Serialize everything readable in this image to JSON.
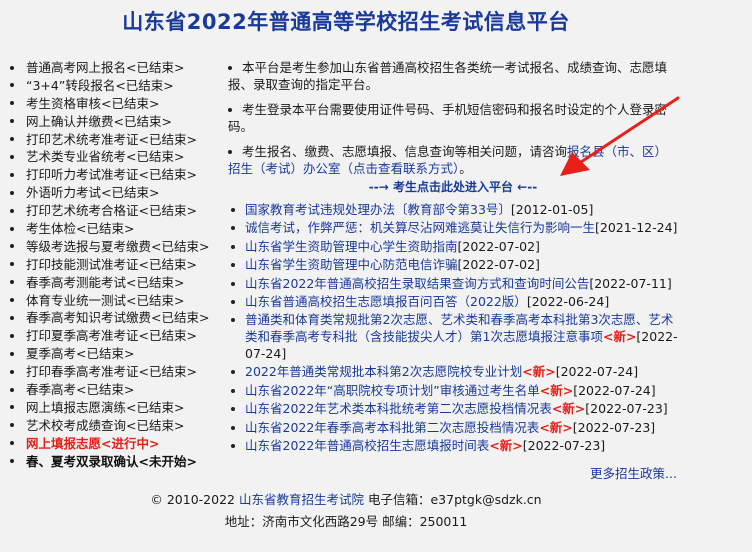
{
  "page_title": "山东省2022年普通高等学校招生考试信息平台",
  "left_nav": [
    {
      "label": "普通高考网上报名<已结束>",
      "state": "done"
    },
    {
      "label": "“3+4”转段报名<已结束>",
      "state": "done"
    },
    {
      "label": "考生资格审核<已结束>",
      "state": "done"
    },
    {
      "label": "网上确认并缴费<已结束>",
      "state": "done"
    },
    {
      "label": "打印艺术统考准考证<已结束>",
      "state": "done"
    },
    {
      "label": "艺术类专业省统考<已结束>",
      "state": "done"
    },
    {
      "label": "打印听力考试准考证<已结束>",
      "state": "done"
    },
    {
      "label": "外语听力考试<已结束>",
      "state": "done"
    },
    {
      "label": "打印艺术统考合格证<已结束>",
      "state": "done"
    },
    {
      "label": "考生体检<已结束>",
      "state": "done"
    },
    {
      "label": "等级考选报与夏考缴费<已结束>",
      "state": "done"
    },
    {
      "label": "打印技能测试准考证<已结束>",
      "state": "done"
    },
    {
      "label": "春季高考测能考试<已结束>",
      "state": "done"
    },
    {
      "label": "体育专业统一测试<已结束>",
      "state": "done"
    },
    {
      "label": "春季高考知识考试缴费<已结束>",
      "state": "done"
    },
    {
      "label": "打印夏季高考准考证<已结束>",
      "state": "done"
    },
    {
      "label": "夏季高考<已结束>",
      "state": "done"
    },
    {
      "label": "打印春季高考准考证<已结束>",
      "state": "done"
    },
    {
      "label": "春季高考<已结束>",
      "state": "done"
    },
    {
      "label": "网上填报志愿演练<已结束>",
      "state": "done"
    },
    {
      "label": "艺术校考成绩查询<已结束>",
      "state": "done"
    },
    {
      "label": "网上填报志愿<进行中>",
      "state": "active"
    },
    {
      "label": "春、夏考双录取确认<未开始>",
      "state": "pending"
    }
  ],
  "intro": {
    "p1": "本平台是考生参加山东省普通高校招生各类统一考试报名、成绩查询、志愿填报、录取查询的指定平台。",
    "p2": "考生登录本平台需要使用证件号码、手机短信密码和报名时设定的个人登录密码。",
    "p3_prefix": "考生报名、缴费、志愿填报、信息查询等相关问题，请咨询",
    "p3_link": "报名县（市、区）招生（考试）办公室（点击查看联系方式）",
    "p3_suffix": "。"
  },
  "enter_link": "--→ 考生点击此处进入平台 ←--",
  "news": [
    {
      "title": "国家教育考试违规处理办法〔教育部令第33号〕",
      "new": "",
      "date": "[2012-01-05]"
    },
    {
      "title": "诚信考试，作弊严惩：机关算尽沾网难逃莫让失信行为影响一生",
      "new": "",
      "date": "[2021-12-24]"
    },
    {
      "title": "山东省学生资助管理中心学生资助指南",
      "new": "",
      "date": "[2022-07-02]"
    },
    {
      "title": "山东省学生资助管理中心防范电信诈骗",
      "new": "",
      "date": "[2022-07-02]"
    },
    {
      "title": "山东省2022年普通高校招生录取结果查询方式和查询时间公告",
      "new": "",
      "date": "[2022-07-11]"
    },
    {
      "title": "山东省普通高校招生志愿填报百问百答（2022版）",
      "new": "",
      "date": "[2022-06-24]"
    },
    {
      "title": "普通类和体育类常规批第2次志愿、艺术类和春季高考本科批第3次志愿、艺术类和春季高考专科批（含技能拔尖人才）第1次志愿填报注意事项",
      "new": "<新>",
      "date": "[2022-07-24]"
    },
    {
      "title": "2022年普通类常规批本科第2次志愿院校专业计划",
      "new": "<新>",
      "date": "[2022-07-24]"
    },
    {
      "title": "山东省2022年“高职院校专项计划”审核通过考生名单",
      "new": "<新>",
      "date": "[2022-07-24]"
    },
    {
      "title": "山东省2022年艺术类本科批统考第二次志愿投档情况表",
      "new": "<新>",
      "date": "[2022-07-23]"
    },
    {
      "title": "山东省2022年春季高考本科批第二次志愿投档情况表",
      "new": "<新>",
      "date": "[2022-07-23]"
    },
    {
      "title": "山东省2022年普通高校招生志愿填报时间表",
      "new": "<新>",
      "date": "[2022-07-23]"
    }
  ],
  "more_link": "更多招生政策...",
  "footer": {
    "copyright": "© 2010-2022",
    "org": "山东省教育招生考试院",
    "email_label": "电子信箱：",
    "email": "e37ptgk@sdzk.cn",
    "address": "地址：济南市文化西路29号 邮编：250011"
  },
  "colors": {
    "primary_blue": "#1a3a99",
    "active_red": "#e8201a",
    "arrow_red": "#e8201a",
    "background": "#f2f2f2"
  },
  "icons": [
    "red-arrow-annotation-icon"
  ]
}
